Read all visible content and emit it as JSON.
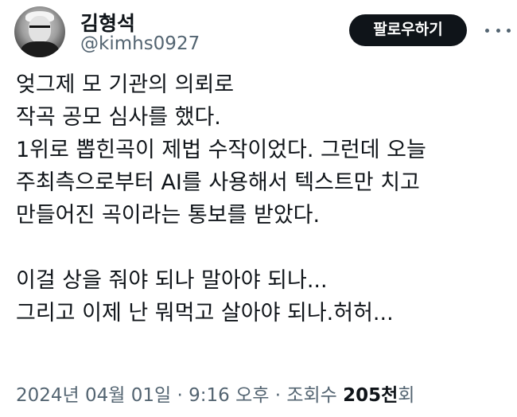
{
  "header": {
    "display_name": "김형석",
    "handle": "@kimhs0927",
    "follow_label": "팔로우하기"
  },
  "tweet": {
    "lines": [
      "엊그제 모 기관의 의뢰로",
      "작곡 공모 심사를 했다.",
      "1위로 뽑힌곡이 제법 수작이었다. 그런데 오늘",
      "주최측으로부터 AI를 사용해서 텍스트만 치고",
      "만들어진 곡이라는 통보를 받았다.",
      "",
      "이걸 상을 줘야 되나 말아야 되나...",
      "그리고 이제 난 뭐먹고 살아야 되나.허허..."
    ]
  },
  "meta": {
    "date": "2024년 04월 01일",
    "sep1": " · ",
    "time": "9:16 오후",
    "sep2": " · ",
    "views_label": "조회수 ",
    "views_count": "205천",
    "views_suffix": "회"
  },
  "icons": {
    "more": "more-horizontal-icon"
  }
}
